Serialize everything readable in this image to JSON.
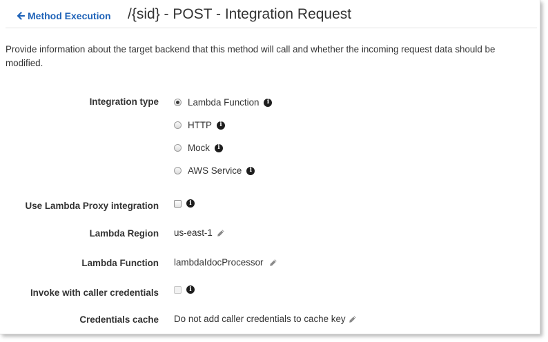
{
  "header": {
    "back_link": "Method Execution",
    "title": "/{sid} - POST - Integration Request"
  },
  "description": "Provide information about the target backend that this method will call and whether the incoming request data should be modified.",
  "integration_type": {
    "label": "Integration type",
    "options": [
      {
        "label": "Lambda Function",
        "selected": true
      },
      {
        "label": "HTTP",
        "selected": false
      },
      {
        "label": "Mock",
        "selected": false
      },
      {
        "label": "AWS Service",
        "selected": false
      }
    ]
  },
  "proxy": {
    "label": "Use Lambda Proxy integration",
    "checked": false
  },
  "region": {
    "label": "Lambda Region",
    "value": "us-east-1"
  },
  "function": {
    "label": "Lambda Function",
    "value": "lambdaIdocProcessor"
  },
  "caller_credentials": {
    "label": "Invoke with caller credentials",
    "checked": false,
    "disabled": true
  },
  "credentials_cache": {
    "label": "Credentials cache",
    "value": "Do not add caller credentials to cache key"
  },
  "colors": {
    "link": "#1f63b8",
    "text": "#333333",
    "info_icon": "#1e1e1e",
    "pencil": "#8a8a8a"
  },
  "icons": {
    "back": "arrow-left-icon",
    "info": "info-circle-icon",
    "edit": "pencil-icon"
  }
}
